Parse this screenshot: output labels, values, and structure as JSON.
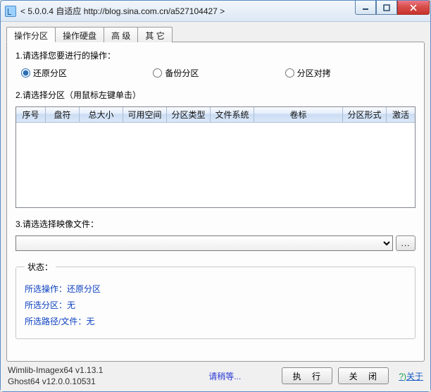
{
  "window": {
    "title": "< 5.0.0.4 自适应 http://blog.sina.com.cn/a527104427 >"
  },
  "tabs": {
    "t0": "操作分区",
    "t1": "操作硬盘",
    "t2": "高 级",
    "t3": "其 它"
  },
  "section1": {
    "label": "1.请选择您要进行的操作：",
    "opt0": "还原分区",
    "opt1": "备份分区",
    "opt2": "分区对拷"
  },
  "section2": {
    "label": "2.请选择分区（用鼠标左键单击）",
    "cols": {
      "c0": "序号",
      "c1": "盘符",
      "c2": "总大小",
      "c3": "可用空间",
      "c4": "分区类型",
      "c5": "文件系统",
      "c6": "卷标",
      "c7": "分区形式",
      "c8": "激活"
    }
  },
  "section3": {
    "label": "3.请选选择映像文件：",
    "browse": "..."
  },
  "status": {
    "legend": "状态：",
    "l0": "所选操作：还原分区",
    "l1": "所选分区：无",
    "l2": "所选路径/文件：无"
  },
  "footer": {
    "ver1": "Wimlib-Imagex64 v1.13.1",
    "ver2": "Ghost64 v12.0.0.10531",
    "wait": "请稍等...",
    "exec": "执 行",
    "close": "关 闭",
    "aboutQ": "?)",
    "about": "关于"
  }
}
